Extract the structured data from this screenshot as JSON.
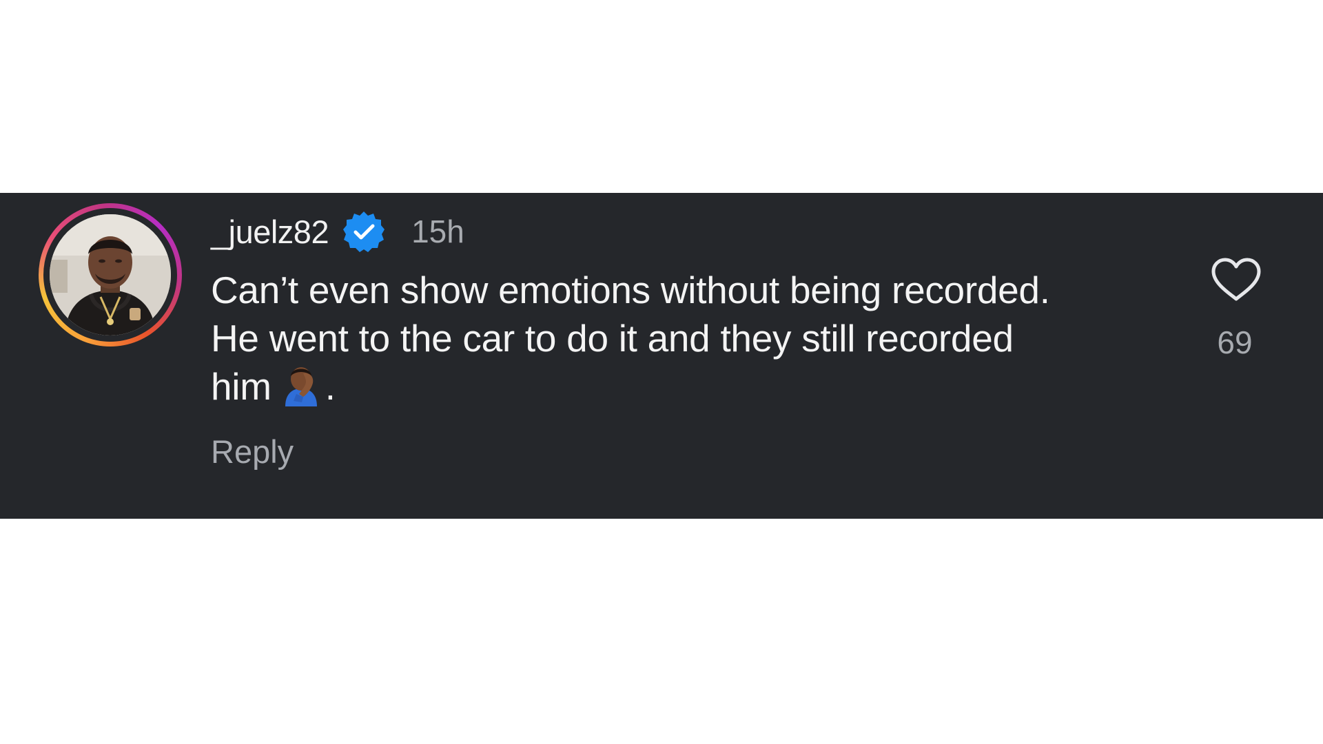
{
  "comment": {
    "username": "_juelz82",
    "verified": true,
    "timestamp": "15h",
    "text_line1": "Can’t even show emotions without being recorded.",
    "text_line2": "He went to the car to do it and they still recorded",
    "text_line3": "him",
    "emoji": "man-facepalming-emoji",
    "text_end": ".",
    "reply_label": "Reply",
    "like_count": "69"
  },
  "icons": {
    "avatar": "profile-photo",
    "verified": "verified-badge-icon",
    "like": "heart-outline-icon"
  },
  "colors": {
    "panel_background": "#25272b",
    "text_primary": "#f4f4f4",
    "text_secondary": "#a8abb0",
    "verified_blue": "#1d8df2"
  }
}
